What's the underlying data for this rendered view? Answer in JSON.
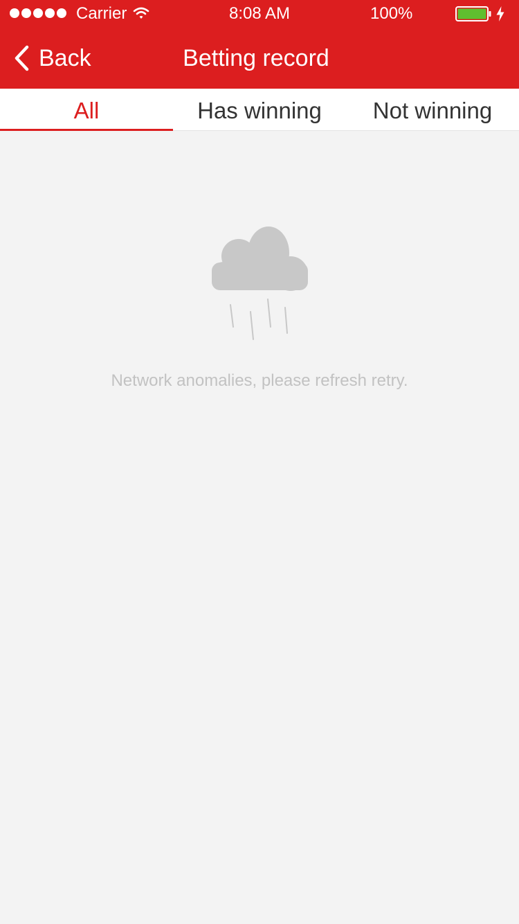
{
  "status_bar": {
    "carrier": "Carrier",
    "time": "8:08 AM",
    "battery_percent": "100%",
    "battery_color": "#5fbf2f"
  },
  "nav": {
    "back_label": "Back",
    "title": "Betting record"
  },
  "tabs": [
    {
      "label": "All",
      "active": true
    },
    {
      "label": "Has winning",
      "active": false
    },
    {
      "label": "Not winning",
      "active": false
    }
  ],
  "empty_state": {
    "icon": "cloud-rain-icon",
    "message": "Network anomalies, please refresh retry."
  },
  "colors": {
    "brand": "#dc1e1f",
    "background": "#f3f3f3",
    "muted_text": "#c2c2c2",
    "icon_gray": "#c8c8c8"
  }
}
